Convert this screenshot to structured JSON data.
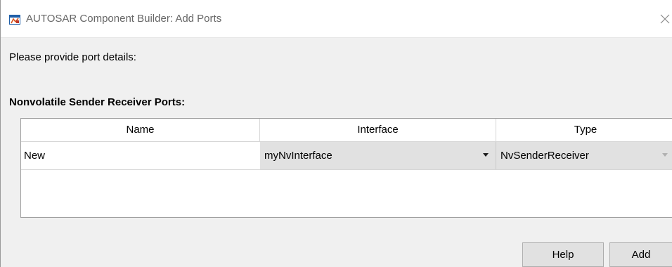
{
  "window": {
    "title": "AUTOSAR Component Builder: Add Ports",
    "close_icon": "close-icon",
    "app_icon": "simulink-app-icon"
  },
  "dialog": {
    "prompt": "Please provide port details:",
    "section_heading": "Nonvolatile Sender Receiver Ports:"
  },
  "table": {
    "columns": [
      "Name",
      "Interface",
      "Type"
    ],
    "rows": [
      {
        "name": "New",
        "interface": "myNvInterface",
        "type": "NvSenderReceiver"
      }
    ]
  },
  "buttons": {
    "help_label": "Help",
    "add_label": "Add"
  },
  "colors": {
    "background": "#f0f0f0",
    "combo_background": "#e1e1e1",
    "title_text": "#666666"
  }
}
